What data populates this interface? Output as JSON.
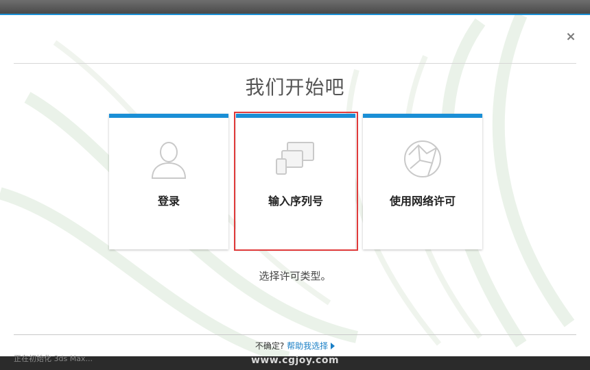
{
  "dialog": {
    "title": "我们开始吧",
    "close_label": "×",
    "subtitle": "选择许可类型。"
  },
  "cards": [
    {
      "label": "登录",
      "icon": "user-silhouette-icon"
    },
    {
      "label": "输入序列号",
      "icon": "devices-icon"
    },
    {
      "label": "使用网络许可",
      "icon": "network-globe-icon"
    }
  ],
  "footer": {
    "question": "不确定?",
    "help_link": "帮助我选择"
  },
  "status": {
    "text": "正在初始化 3ds Max...",
    "watermark": "www.cgjoy.com"
  },
  "colors": {
    "accent": "#1a8fd6",
    "highlight": "#e03a3a",
    "link": "#1a7fc6"
  }
}
